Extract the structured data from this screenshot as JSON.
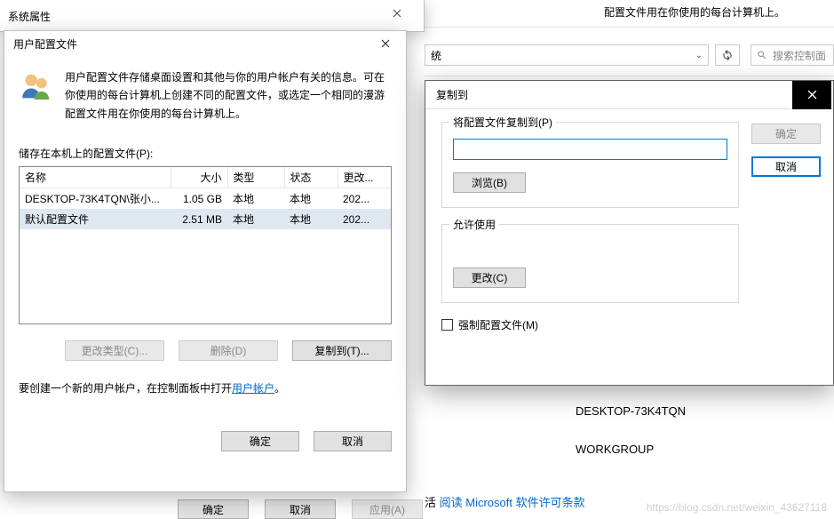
{
  "background": {
    "top_text": "配置文件用在你使用的每台计算机上。",
    "select_text": "统",
    "search_placeholder": "搜索控制面",
    "value_computer": "DESKTOP-73K4TQN",
    "value_workgroup": "WORKGROUP",
    "activate_prefix": "活 ",
    "activate_link": "阅读 Microsoft 软件许可条款",
    "watermark": "https://blog.csdn.net/weixin_43627118",
    "bottom_ok": "确定",
    "bottom_cancel": "取消",
    "bottom_apply": "应用(A)"
  },
  "sysprops": {
    "title": "系统属性"
  },
  "userprofiles": {
    "title": "用户配置文件",
    "description": "用户配置文件存储桌面设置和其他与你的用户帐户有关的信息。可在你使用的每台计算机上创建不同的配置文件，或选定一个相同的漫游配置文件用在你使用的每台计算机上。",
    "stored_label": "储存在本机上的配置文件(P):",
    "columns": {
      "name": "名称",
      "size": "大小",
      "type": "类型",
      "status": "状态",
      "modified": "更改..."
    },
    "rows": [
      {
        "name": "DESKTOP-73K4TQN\\张小...",
        "size": "1.05 GB",
        "type": "本地",
        "status": "本地",
        "modified": "202..."
      },
      {
        "name": "默认配置文件",
        "size": "2.51 MB",
        "type": "本地",
        "status": "本地",
        "modified": "202..."
      }
    ],
    "change_type": "更改类型(C)...",
    "delete": "删除(D)",
    "copy_to": "复制到(T)...",
    "create_text_prefix": "要创建一个新的用户帐户，在控制面板中打开",
    "user_accounts_link": "用户帐户",
    "create_text_suffix": "。",
    "ok": "确定",
    "cancel": "取消"
  },
  "copyto": {
    "title": "复制到",
    "group1_legend": "将配置文件复制到(P)",
    "input_value": "",
    "browse": "浏览(B)",
    "group2_legend": "允许使用",
    "change": "更改(C)",
    "mandatory": "强制配置文件(M)",
    "ok": "确定",
    "cancel": "取消"
  }
}
